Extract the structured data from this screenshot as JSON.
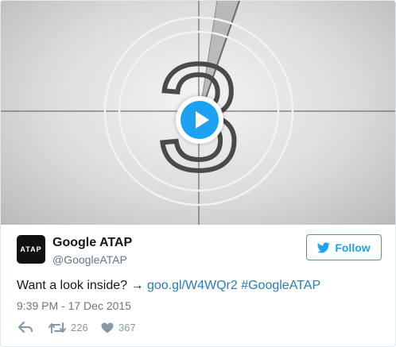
{
  "media": {
    "type": "video",
    "countdown_number": "3"
  },
  "author": {
    "avatar_text": "ATAP",
    "display_name": "Google ATAP",
    "screen_name": "@GoogleATAP"
  },
  "follow_button": {
    "label": "Follow"
  },
  "tweet": {
    "text_prefix": "Want a look inside? → ",
    "link": "goo.gl/W4WQr2",
    "hashtag": "#GoogleATAP",
    "timestamp": "9:39 PM - 17 Dec 2015"
  },
  "actions": {
    "retweet_count": "226",
    "like_count": "367"
  },
  "colors": {
    "accent": "#1da1f2",
    "link": "#2b7bb9",
    "muted": "#657786"
  },
  "icons": [
    "play-icon",
    "twitter-bird-icon",
    "reply-icon",
    "retweet-icon",
    "heart-icon"
  ]
}
